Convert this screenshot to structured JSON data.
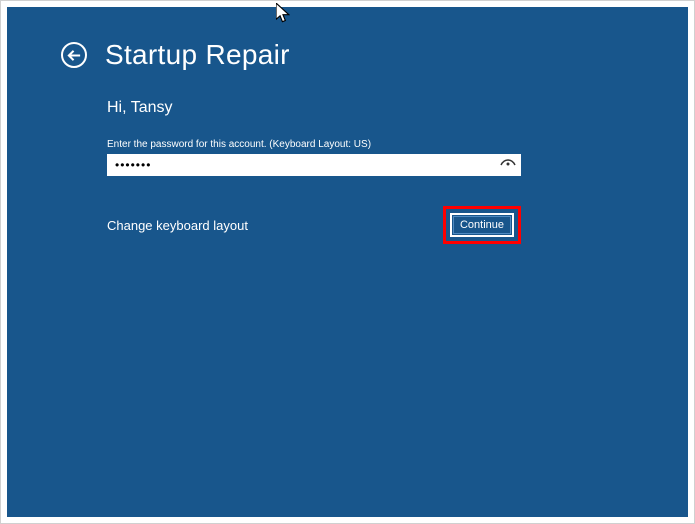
{
  "header": {
    "title": "Startup Repair"
  },
  "content": {
    "greeting": "Hi, Tansy",
    "instruction": "Enter the password for this account. (Keyboard Layout: US)",
    "password_value": "•••••••",
    "change_keyboard_label": "Change keyboard layout",
    "continue_label": "Continue"
  }
}
